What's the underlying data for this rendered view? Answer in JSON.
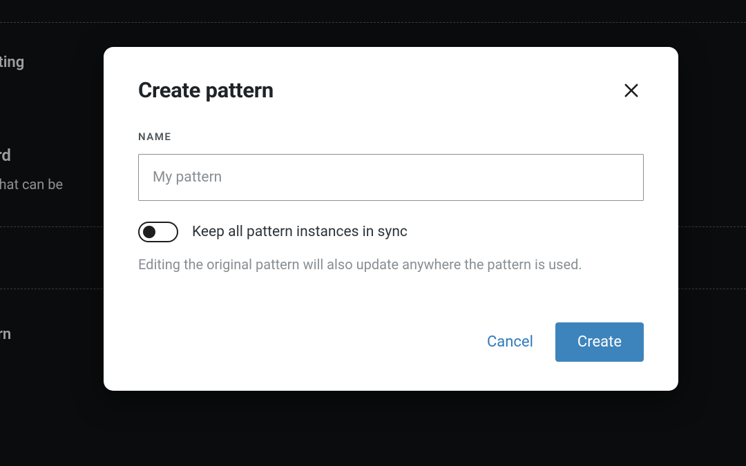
{
  "background": {
    "item1": "sting",
    "item2": "rd",
    "item2_sub": "that can be",
    "item3": "rn"
  },
  "dialog": {
    "title": "Create pattern",
    "name_label": "Name",
    "name_placeholder": "My pattern",
    "name_value": "",
    "toggle_label": "Keep all pattern instances in sync",
    "toggle_description": "Editing the original pattern will also update anywhere the pattern is used.",
    "toggle_checked": false,
    "cancel_label": "Cancel",
    "create_label": "Create"
  }
}
